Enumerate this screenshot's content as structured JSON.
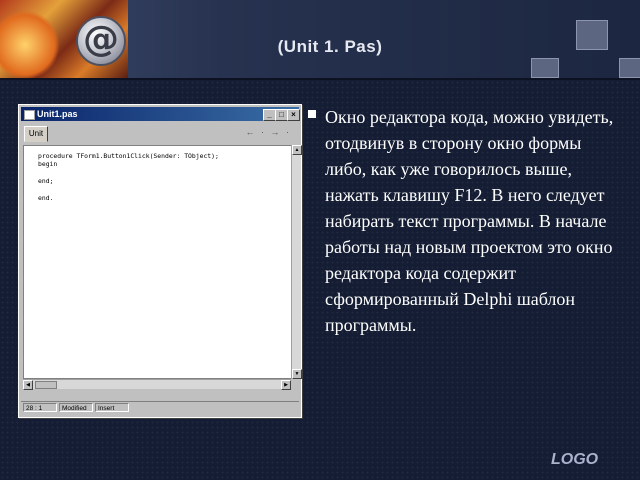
{
  "slide": {
    "title": "(Unit 1. Pas)",
    "body": "Окно редактора кода, можно увидеть, отодвинув в сторону окно формы либо, как уже говорилось выше, нажать клавишу F12. В него следует набирать текст программы. В начале работы над новым проектом это окно редактора кода содержит сформированный Delphi шаблон программы.",
    "logo": "LOGO"
  },
  "editor_window": {
    "title": "Unit1.pas",
    "minimize": "_",
    "maximize": "□",
    "close": "×",
    "tab_label": "Unit",
    "nav_arrows": "← · → ·",
    "code": "procedure TForm1.Button1Click(Sender: TObject);\nbegin\n\nend;\n\nend.",
    "status": {
      "position": "28 : 1",
      "modified": "Modified",
      "mode": "Insert"
    }
  },
  "colors": {
    "background": "#141d33",
    "titlebar": "#0a246a",
    "text": "#ffffff"
  }
}
